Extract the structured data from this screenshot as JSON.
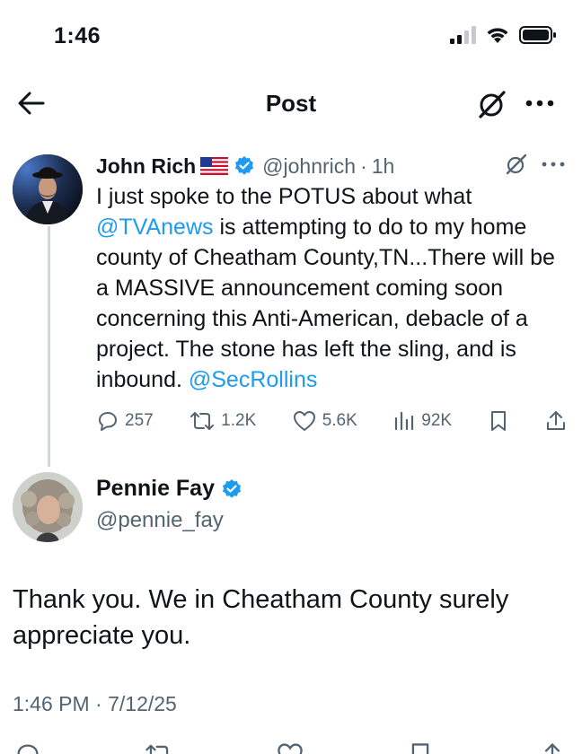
{
  "status_bar": {
    "time": "1:46"
  },
  "nav": {
    "title": "Post"
  },
  "reply": {
    "author_name": "John Rich",
    "handle": "@johnrich",
    "separator": "·",
    "time_ago": "1h",
    "body_line1": "I just spoke to the POTUS about what ",
    "mention1": "@TVAnews",
    "body_line2": " is attempting to do to my home county of Cheatham County,TN...There will be a MASSIVE announcement coming soon concerning this Anti-American, debacle of a project. The stone has left the sling, and is inbound. ",
    "mention2": "@SecRollins",
    "stats": {
      "replies": "257",
      "reposts": "1.2K",
      "likes": "5.6K",
      "views": "92K"
    }
  },
  "main_post": {
    "author_name": "Pennie Fay",
    "handle": "@pennie_fay",
    "body": "Thank you. We in Cheatham County surely appreciate you.",
    "timestamp": "1:46 PM · 7/12/25"
  },
  "icons": {
    "back": "arrow-left-icon",
    "grok": "grok-icon",
    "more": "more-horizontal-icon",
    "verified": "verified-badge-icon",
    "flag": "us-flag-icon",
    "reply": "reply-icon",
    "repost": "repost-icon",
    "like": "heart-icon",
    "views": "views-icon",
    "bookmark": "bookmark-icon",
    "share": "share-icon"
  },
  "colors": {
    "accent": "#1d9bf0",
    "text": "#0f1419",
    "muted": "#536471"
  }
}
